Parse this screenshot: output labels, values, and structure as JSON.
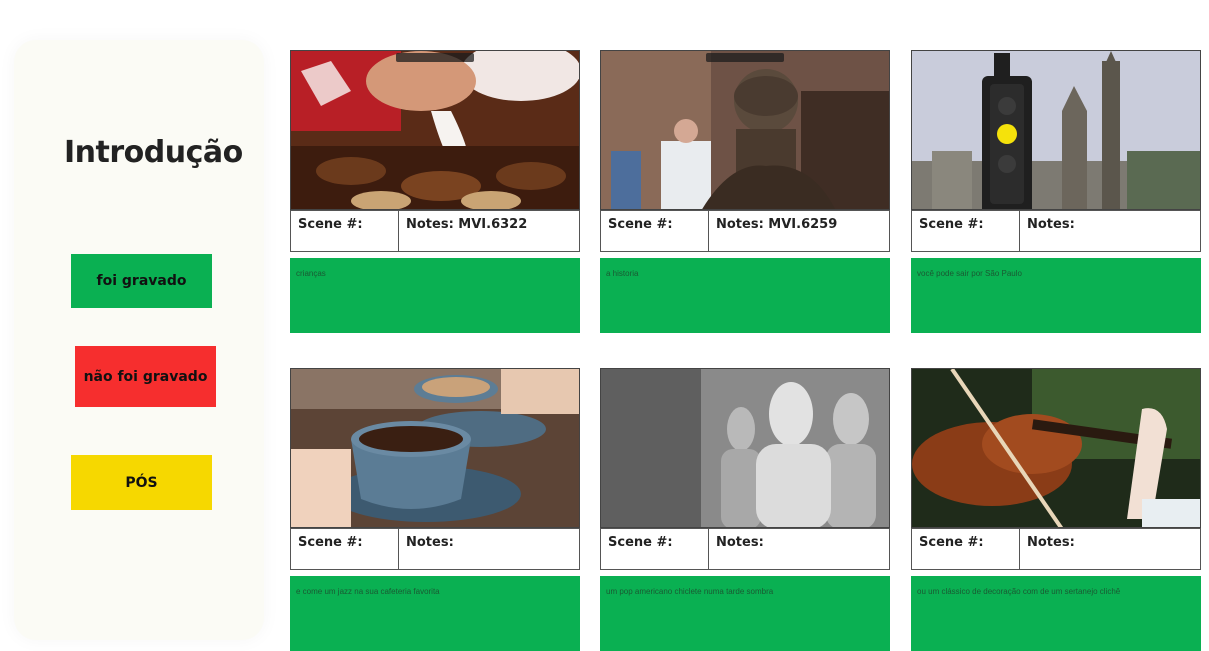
{
  "sidebar": {
    "title": "Introdução",
    "legend": [
      {
        "label": "foi gravado",
        "color": "#0ab052"
      },
      {
        "label": "não foi gravado",
        "color": "#f62e2e"
      },
      {
        "label": "PÓS",
        "color": "#f6d800"
      }
    ]
  },
  "cards": [
    {
      "scene_label": "Scene #:",
      "notes_label": "Notes: MVI.6322",
      "description": "crianças",
      "image": "fondue-dessert-image"
    },
    {
      "scene_label": "Scene #:",
      "notes_label": "Notes: MVI.6259",
      "description": "a historia",
      "image": "statue-street-image"
    },
    {
      "scene_label": "Scene #:",
      "notes_label": "Notes:",
      "description": "você pode sair por São Paulo",
      "image": "traffic-light-image"
    },
    {
      "scene_label": "Scene #:",
      "notes_label": "Notes:",
      "description": "e come um jazz na sua cafeteria favorita",
      "image": "coffee-cups-image"
    },
    {
      "scene_label": "Scene #:",
      "notes_label": "Notes:",
      "description": "um pop americano chiclete numa tarde sombra",
      "image": "mannequins-image"
    },
    {
      "scene_label": "Scene #:",
      "notes_label": "Notes:",
      "description": "ou um clássico de decoração com de um sertanejo clichê",
      "image": "violin-image"
    }
  ],
  "colors": {
    "green": "#0ab052",
    "red": "#f62e2e",
    "yellow": "#f6d800"
  }
}
